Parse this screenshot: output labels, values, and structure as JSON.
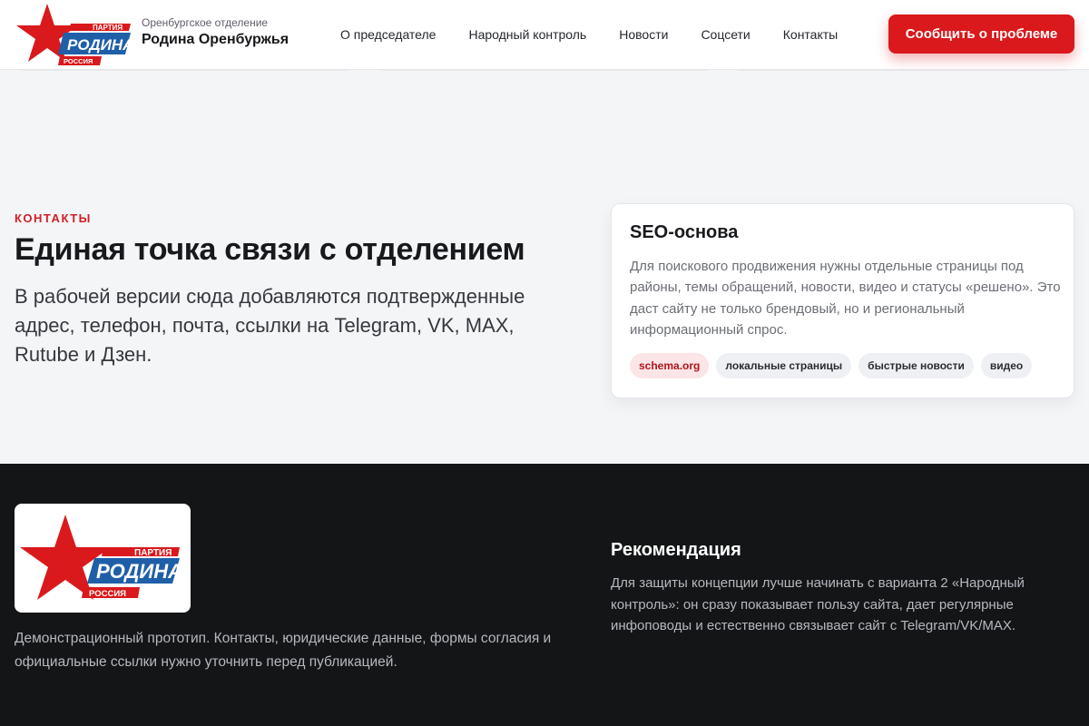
{
  "header": {
    "brand_sub": "Оренбургское отделение",
    "brand_name": "Родина Оренбуржья",
    "nav": [
      "О председателе",
      "Народный контроль",
      "Новости",
      "Соцсети",
      "Контакты"
    ],
    "cta_label": "Сообщить о проблеме"
  },
  "logo": {
    "party": "ПАРТИЯ",
    "name": "РОДИНА",
    "country": "РОССИЯ"
  },
  "contacts": {
    "kicker": "КОНТАКТЫ",
    "title": "Единая точка связи с отделением",
    "lead": "В рабочей версии сюда добавляются подтвержденные адрес, телефон, почта, ссылки на Telegram, VK, MAX, Rutube и Дзен."
  },
  "seo_card": {
    "title": "SEO-основа",
    "text": "Для поискового продвижения нужны отдельные страницы под районы, темы обращений, новости, видео и статусы «решено». Это даст сайту не только брендовый, но и региональный информационный спрос.",
    "tags": [
      "schema.org",
      "локальные страницы",
      "быстрые новости",
      "видео"
    ]
  },
  "footer": {
    "note": "Демонстрационный прототип. Контакты, юридические данные, формы согласия и официальные ссылки нужно уточнить перед публикацией.",
    "rec_title": "Рекомендация",
    "rec_text": "Для защиты концепции лучше начинать с варианта 2 «Народный контроль»: он сразу показывает пользу сайта, дает регулярные инфоповоды и естественно связывает сайт с Telegram/VK/MAX."
  },
  "colors": {
    "accent": "#d9191c",
    "logo_blue": "#1f5fa8",
    "footer_bg": "#141517",
    "page_bg": "#f4f5f7"
  }
}
